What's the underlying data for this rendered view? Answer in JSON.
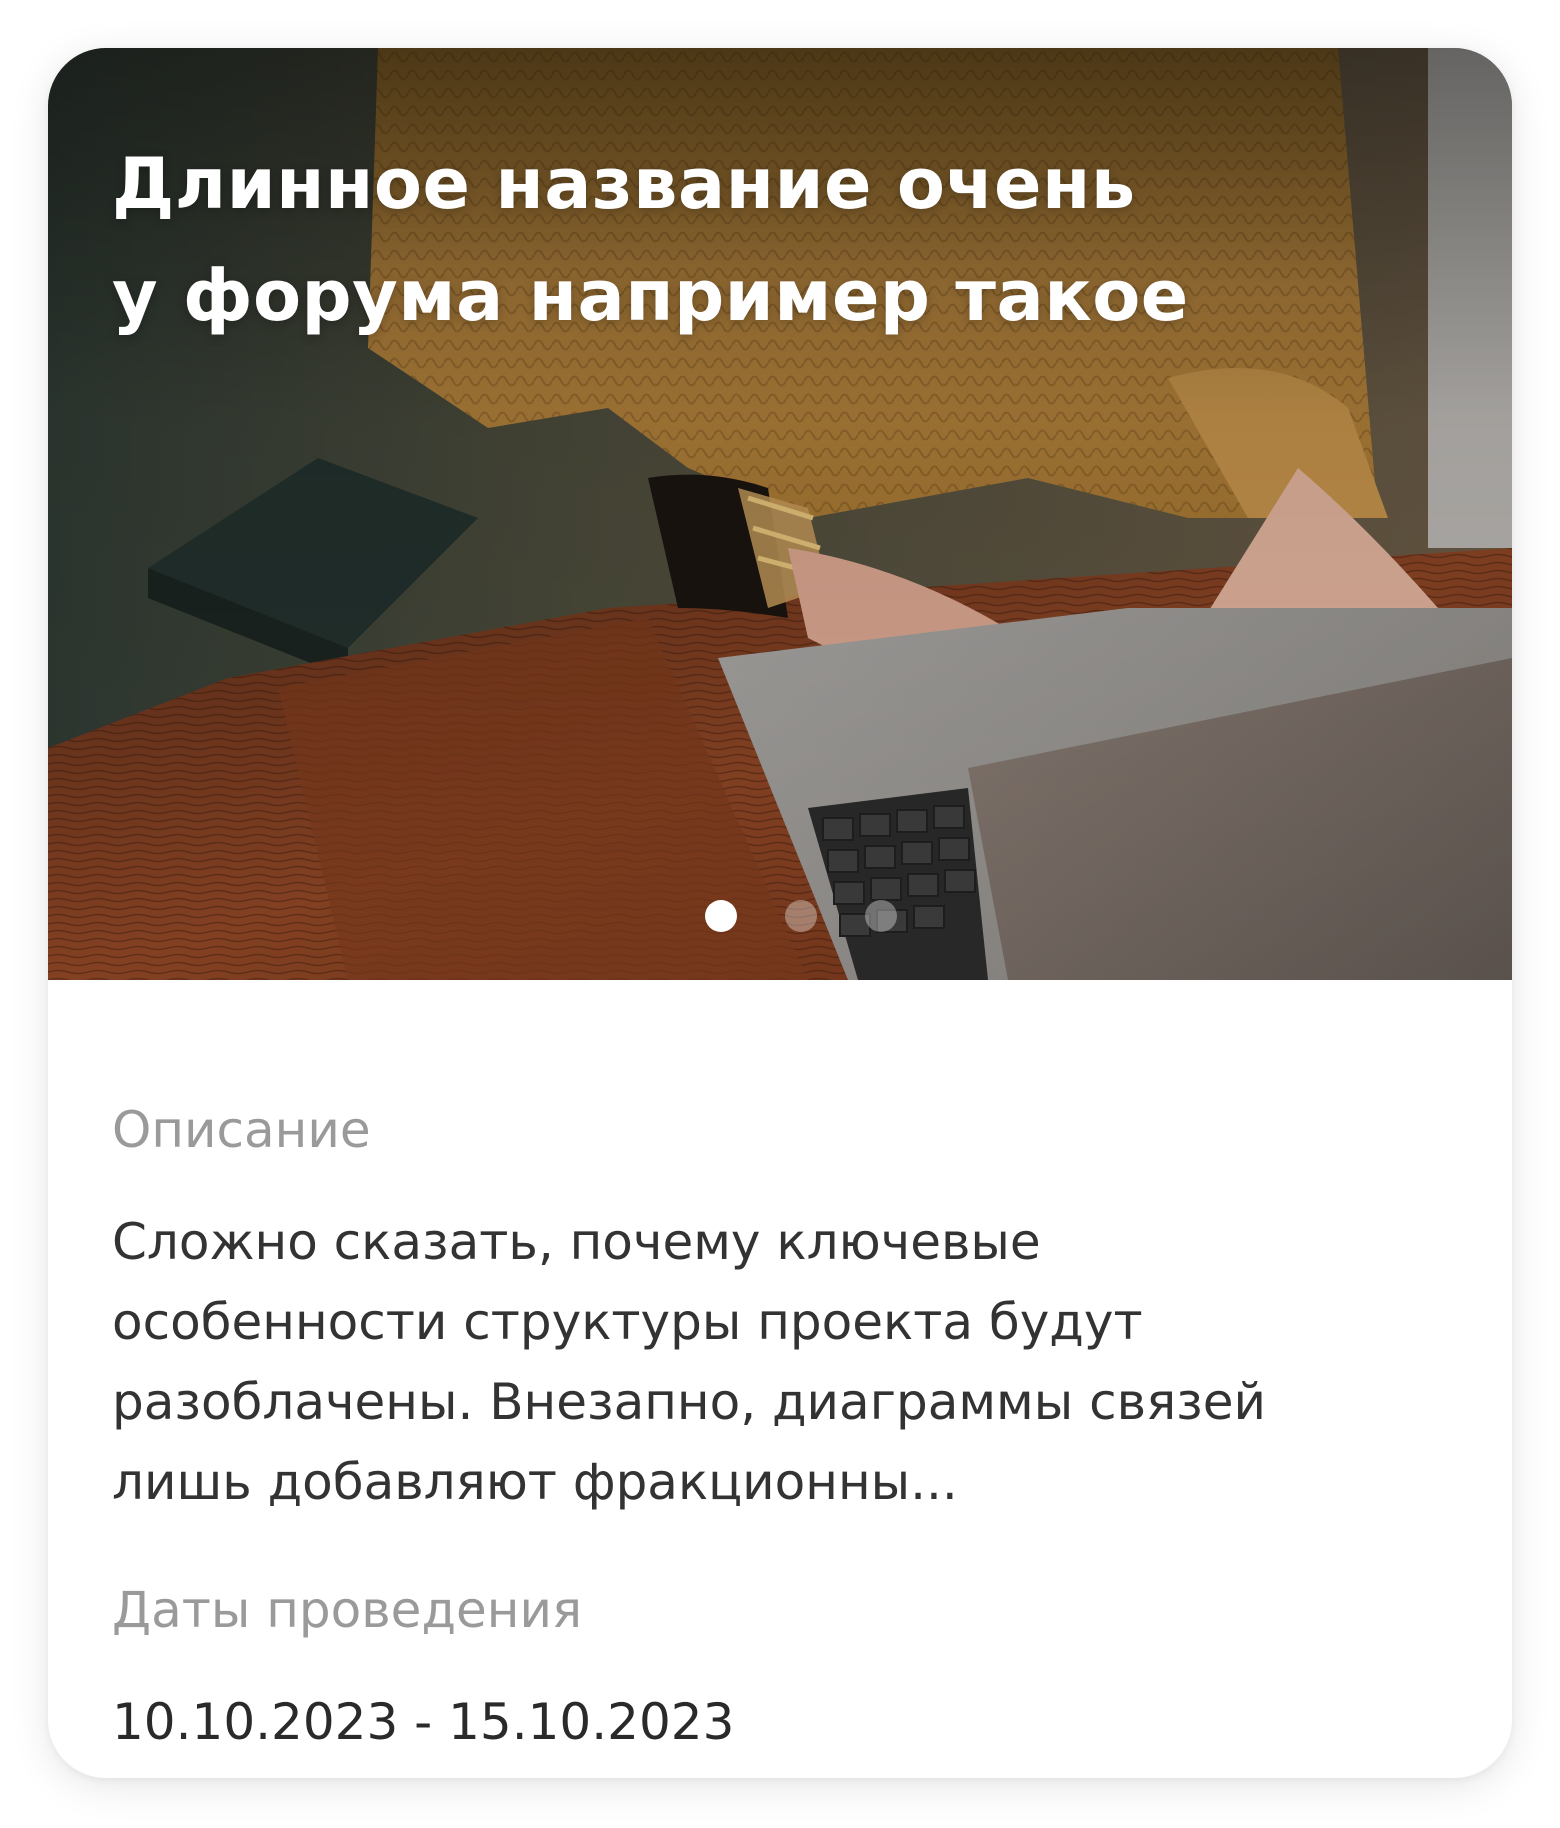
{
  "card": {
    "title_line1": "Длинное название очень",
    "title_line2": "у форума например такое",
    "carousel": {
      "slide_count": 3,
      "active_index": 0
    },
    "description_label": "Описание",
    "description_lines": [
      "Сложно сказать, почему ключевые",
      "особенности структуры проекта будут",
      "разоблачены. Внезапно, диаграммы связей",
      "лишь добавляют фракционны..."
    ],
    "dates_label": "Даты проведения",
    "dates_value": "10.10.2023 - 15.10.2023"
  },
  "colors": {
    "label": "#9a9a9a",
    "body_text": "#333333",
    "title": "#ffffff",
    "sweater": "#b8863f",
    "table_wood": "#7a3c1e"
  }
}
